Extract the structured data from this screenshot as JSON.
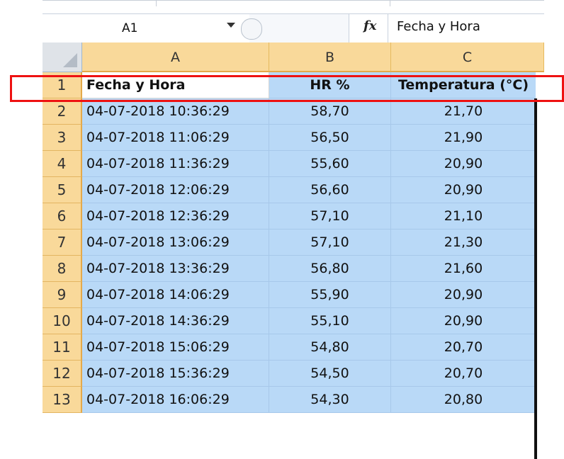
{
  "formula_bar": {
    "name_box": "A1",
    "fx_icon": "function-icon",
    "formula": "Fecha y Hora"
  },
  "columns": [
    "A",
    "B",
    "C"
  ],
  "header_row": {
    "row_number": "1",
    "cells": [
      "Fecha y Hora",
      "HR %",
      "Temperatura (°C)"
    ]
  },
  "rows": [
    {
      "row": "2",
      "fecha": "04-07-2018 10:36:29",
      "hr": "58,70",
      "temp": "21,70"
    },
    {
      "row": "3",
      "fecha": "04-07-2018 11:06:29",
      "hr": "56,50",
      "temp": "21,90"
    },
    {
      "row": "4",
      "fecha": "04-07-2018 11:36:29",
      "hr": "55,60",
      "temp": "20,90"
    },
    {
      "row": "5",
      "fecha": "04-07-2018 12:06:29",
      "hr": "56,60",
      "temp": "20,90"
    },
    {
      "row": "6",
      "fecha": "04-07-2018 12:36:29",
      "hr": "57,10",
      "temp": "21,10"
    },
    {
      "row": "7",
      "fecha": "04-07-2018 13:06:29",
      "hr": "57,10",
      "temp": "21,30"
    },
    {
      "row": "8",
      "fecha": "04-07-2018 13:36:29",
      "hr": "56,80",
      "temp": "21,60"
    },
    {
      "row": "9",
      "fecha": "04-07-2018 14:06:29",
      "hr": "55,90",
      "temp": "20,90"
    },
    {
      "row": "10",
      "fecha": "04-07-2018 14:36:29",
      "hr": "55,10",
      "temp": "20,90"
    },
    {
      "row": "11",
      "fecha": "04-07-2018 15:06:29",
      "hr": "54,80",
      "temp": "20,70"
    },
    {
      "row": "12",
      "fecha": "04-07-2018 15:36:29",
      "hr": "54,50",
      "temp": "20,70"
    },
    {
      "row": "13",
      "fecha": "04-07-2018 16:06:29",
      "hr": "54,30",
      "temp": "20,80"
    }
  ],
  "colors": {
    "header_fill": "#f9d99a",
    "selection_fill": "#b9d9f7",
    "highlight_border": "#ee1111"
  }
}
